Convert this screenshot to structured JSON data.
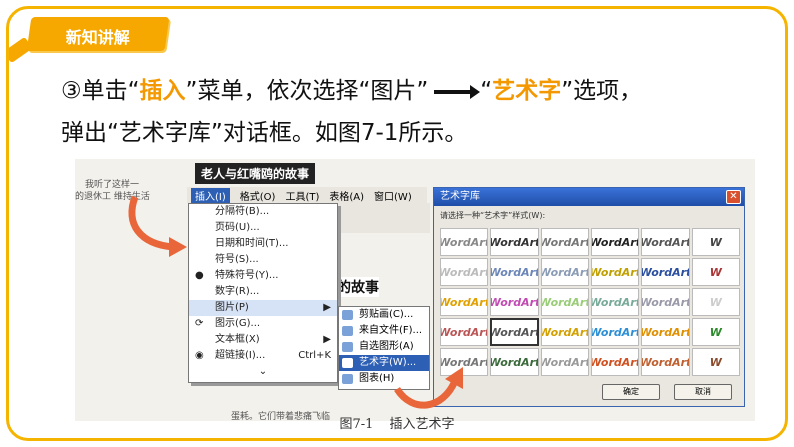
{
  "badge": {
    "label": "新知讲解"
  },
  "instruction": {
    "num": "③",
    "t1": "单击“",
    "insert": "插入",
    "t2": "”菜单，依次选择“图片”",
    "t3": "“",
    "wordart": "艺术字",
    "t4": "”选项，",
    "line2": "弹出“艺术字库”对话框。如图7-1所示。"
  },
  "screenshot": {
    "doc_title": "老人与红嘴鸥的故事",
    "bg_text_1": "我听了这样一",
    "bg_text_2": "的退休工 维持生活",
    "bg_text_3": "蛋耗。它们带着悲痛飞临",
    "story_heading": "的故事",
    "menubar": [
      "插入(I)",
      "格式(O)",
      "工具(T)",
      "表格(A)",
      "窗口(W)"
    ],
    "insert_menu": [
      {
        "label": "分隔符(B)..."
      },
      {
        "label": "页码(U)..."
      },
      {
        "label": "日期和时间(T)..."
      },
      {
        "label": "符号(S)..."
      },
      {
        "label": "特殊符号(Y)..."
      },
      {
        "label": "数字(R)..."
      },
      {
        "label": "图片(P)"
      },
      {
        "label": "图示(G)..."
      },
      {
        "label": "文本框(X)"
      },
      {
        "label": "超链接(I)...",
        "shortcut": "Ctrl+K"
      }
    ],
    "picture_submenu": [
      "剪贴画(C)...",
      "来自文件(F)...",
      "自选图形(A)",
      "艺术字(W)...",
      "图表(H)"
    ],
    "dialog": {
      "title": "艺术字库",
      "close": "✕",
      "prompt": "请选择一种“艺术字”样式(W):",
      "ok": "确定",
      "cancel": "取消",
      "samples": [
        "WordArt",
        "WordArt",
        "WordArt",
        "WordArt",
        "WordArt",
        "W",
        "WordArt",
        "WordArt",
        "WordArt",
        "WordArt",
        "WordArt",
        "W",
        "WordArt",
        "WordArt",
        "WordArt",
        "WordArt",
        "WordArt",
        "W",
        "WordArt",
        "WordArt",
        "WordArt",
        "WordArt",
        "WordArt",
        "W",
        "WordArt",
        "WordArt",
        "WordArt",
        "WordArt",
        "WordArt",
        "W"
      ],
      "sample_colors": [
        "#888",
        "#333",
        "#777",
        "#222",
        "#555",
        "#444",
        "#bbb",
        "#6b86b8",
        "#8a9bb5",
        "#c0a000",
        "#2a4ea0",
        "#a33",
        "#e0a000",
        "#c14bb3",
        "#9c7",
        "#7a9",
        "#99a",
        "#ccc",
        "#b55",
        "#555",
        "#d4a000",
        "#2c8fd6",
        "#e09000",
        "#2a8a2a",
        "#777",
        "#3a6a3a",
        "#999",
        "#d05020",
        "#c06030",
        "#8a4a2a"
      ]
    }
  },
  "caption": {
    "fig": "图7-1",
    "text": "插入艺术字"
  },
  "colors": {
    "accent": "#f39800",
    "frame": "#f5b400"
  }
}
